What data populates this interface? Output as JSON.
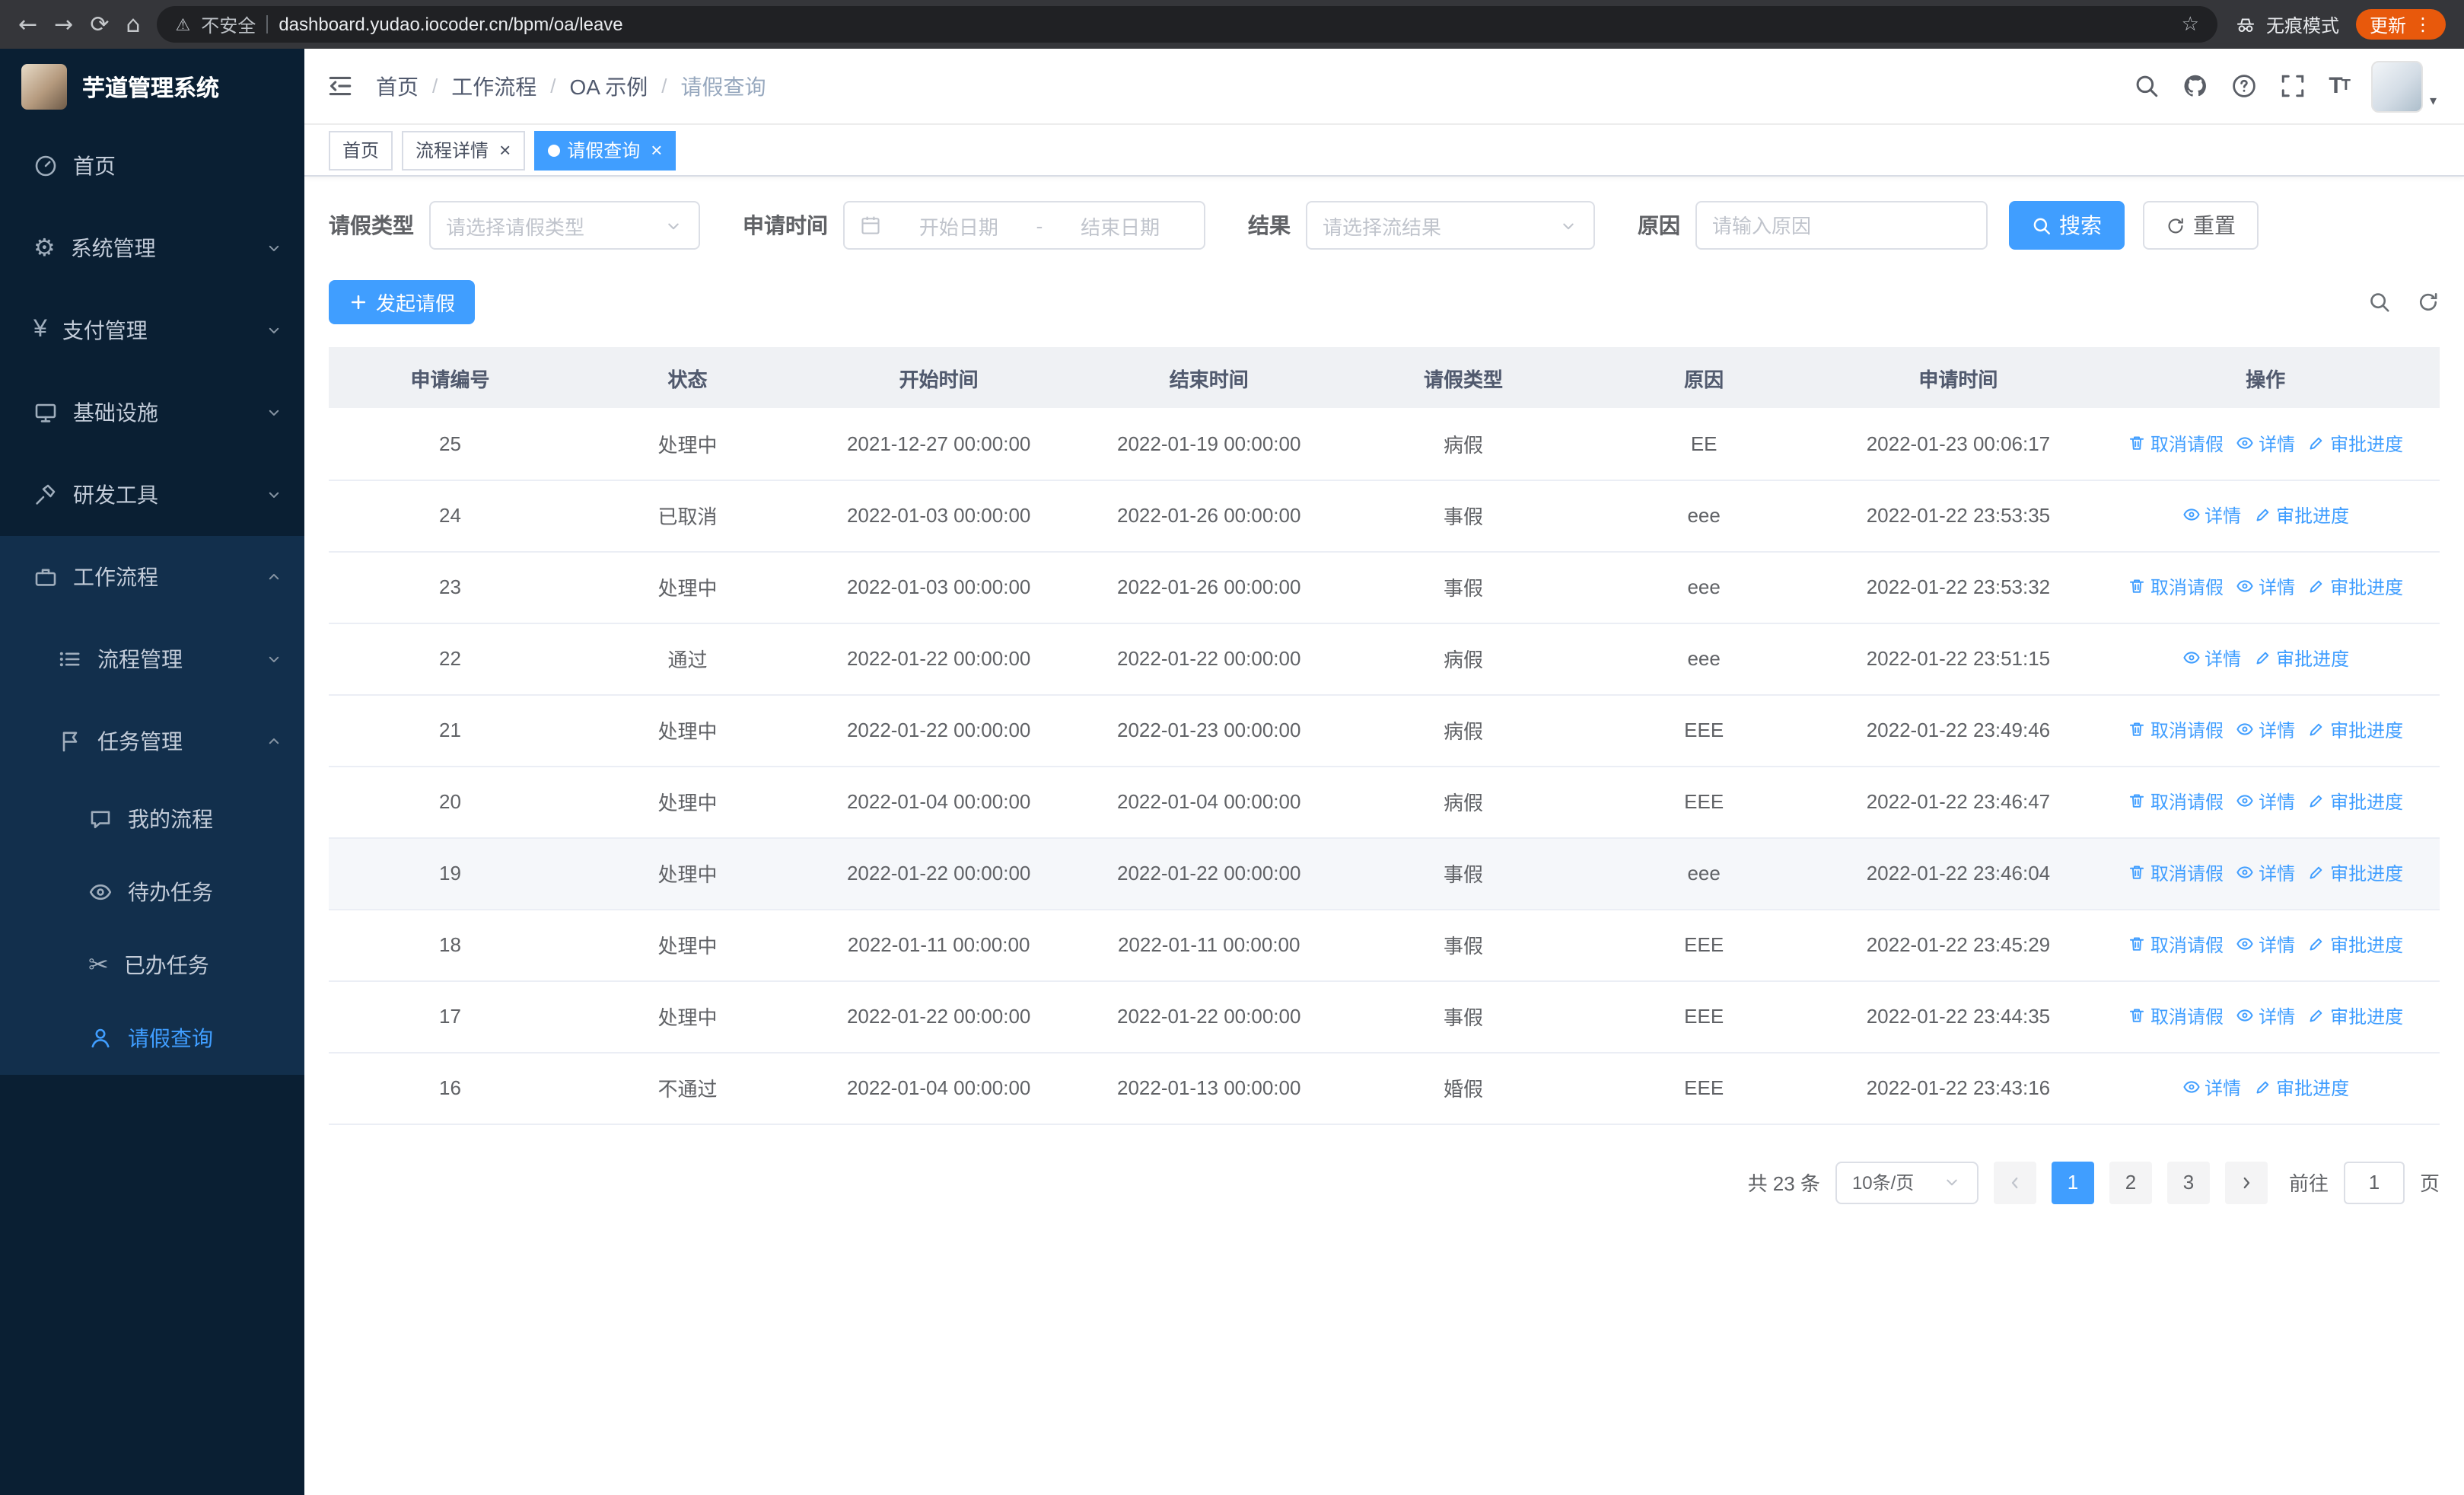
{
  "browser": {
    "security_warning": "不安全",
    "url": "dashboard.yudao.iocoder.cn/bpm/oa/leave",
    "incognito_label": "无痕模式",
    "update_label": "更新"
  },
  "sidebar": {
    "logo_title": "芋道管理系统",
    "menu": [
      {
        "id": "home",
        "label": "首页",
        "icon": "dashboard-icon",
        "level": 1
      },
      {
        "id": "system-mgmt",
        "label": "系统管理",
        "icon": "gear-icon",
        "level": 1,
        "chevron": "down"
      },
      {
        "id": "payment-mgmt",
        "label": "支付管理",
        "icon": "yen-icon",
        "level": 1,
        "chevron": "down"
      },
      {
        "id": "infrastructure",
        "label": "基础设施",
        "icon": "monitor-icon",
        "level": 1,
        "chevron": "down"
      },
      {
        "id": "dev-tools",
        "label": "研发工具",
        "icon": "tools-icon",
        "level": 1,
        "chevron": "down"
      },
      {
        "id": "workflow",
        "label": "工作流程",
        "icon": "briefcase-icon",
        "level": 1,
        "chevron": "up",
        "group": true
      },
      {
        "id": "process-mgmt",
        "label": "流程管理",
        "icon": "list-icon",
        "level": 2,
        "chevron": "down",
        "group": true
      },
      {
        "id": "task-mgmt",
        "label": "任务管理",
        "icon": "flag-icon",
        "level": 2,
        "chevron": "up",
        "group": true
      },
      {
        "id": "my-process",
        "label": "我的流程",
        "icon": "chat-icon",
        "level": 3,
        "group": true
      },
      {
        "id": "todo-task",
        "label": "待办任务",
        "icon": "eye-icon",
        "level": 3,
        "group": true
      },
      {
        "id": "done-task",
        "label": "已办任务",
        "icon": "scissors-icon",
        "level": 3,
        "group": true
      },
      {
        "id": "leave-query",
        "label": "请假查询",
        "icon": "user-icon",
        "level": 3,
        "group": true,
        "active": true
      }
    ]
  },
  "breadcrumb": {
    "separator": "/",
    "items": [
      "首页",
      "工作流程",
      "OA 示例",
      "请假查询"
    ]
  },
  "tabs": [
    {
      "label": "首页",
      "closable": false,
      "active": false
    },
    {
      "label": "流程详情",
      "closable": true,
      "active": false
    },
    {
      "label": "请假查询",
      "closable": true,
      "active": true
    }
  ],
  "filters": {
    "leave_type_label": "请假类型",
    "leave_type_placeholder": "请选择请假类型",
    "apply_time_label": "申请时间",
    "start_date_placeholder": "开始日期",
    "date_separator": "-",
    "end_date_placeholder": "结束日期",
    "result_label": "结果",
    "result_placeholder": "请选择流结果",
    "reason_label": "原因",
    "reason_placeholder": "请输入原因",
    "search_button": "搜索",
    "reset_button": "重置"
  },
  "toolbar": {
    "create_button": "发起请假"
  },
  "table": {
    "columns": [
      "申请编号",
      "状态",
      "开始时间",
      "结束时间",
      "请假类型",
      "原因",
      "申请时间",
      "操作"
    ],
    "action_icons": {
      "取消请假": "delete-icon",
      "详情": "view-icon",
      "审批进度": "edit-icon"
    },
    "action_names": {
      "取消请假": "cancel-leave-link",
      "详情": "detail-link",
      "审批进度": "approval-progress-link"
    },
    "rows": [
      {
        "id": "25",
        "status": "处理中",
        "start_time": "2021-12-27 00:00:00",
        "end_time": "2022-01-19 00:00:00",
        "leave_type": "病假",
        "reason": "EE",
        "apply_time": "2022-01-23 00:06:17",
        "actions": [
          "取消请假",
          "详情",
          "审批进度"
        ]
      },
      {
        "id": "24",
        "status": "已取消",
        "start_time": "2022-01-03 00:00:00",
        "end_time": "2022-01-26 00:00:00",
        "leave_type": "事假",
        "reason": "eee",
        "apply_time": "2022-01-22 23:53:35",
        "actions": [
          "详情",
          "审批进度"
        ]
      },
      {
        "id": "23",
        "status": "处理中",
        "start_time": "2022-01-03 00:00:00",
        "end_time": "2022-01-26 00:00:00",
        "leave_type": "事假",
        "reason": "eee",
        "apply_time": "2022-01-22 23:53:32",
        "actions": [
          "取消请假",
          "详情",
          "审批进度"
        ]
      },
      {
        "id": "22",
        "status": "通过",
        "start_time": "2022-01-22 00:00:00",
        "end_time": "2022-01-22 00:00:00",
        "leave_type": "病假",
        "reason": "eee",
        "apply_time": "2022-01-22 23:51:15",
        "actions": [
          "详情",
          "审批进度"
        ]
      },
      {
        "id": "21",
        "status": "处理中",
        "start_time": "2022-01-22 00:00:00",
        "end_time": "2022-01-23 00:00:00",
        "leave_type": "病假",
        "reason": "EEE",
        "apply_time": "2022-01-22 23:49:46",
        "actions": [
          "取消请假",
          "详情",
          "审批进度"
        ]
      },
      {
        "id": "20",
        "status": "处理中",
        "start_time": "2022-01-04 00:00:00",
        "end_time": "2022-01-04 00:00:00",
        "leave_type": "病假",
        "reason": "EEE",
        "apply_time": "2022-01-22 23:46:47",
        "actions": [
          "取消请假",
          "详情",
          "审批进度"
        ]
      },
      {
        "id": "19",
        "status": "处理中",
        "start_time": "2022-01-22 00:00:00",
        "end_time": "2022-01-22 00:00:00",
        "leave_type": "事假",
        "reason": "eee",
        "apply_time": "2022-01-22 23:46:04",
        "actions": [
          "取消请假",
          "详情",
          "审批进度"
        ],
        "highlighted": true
      },
      {
        "id": "18",
        "status": "处理中",
        "start_time": "2022-01-11 00:00:00",
        "end_time": "2022-01-11 00:00:00",
        "leave_type": "事假",
        "reason": "EEE",
        "apply_time": "2022-01-22 23:45:29",
        "actions": [
          "取消请假",
          "详情",
          "审批进度"
        ]
      },
      {
        "id": "17",
        "status": "处理中",
        "start_time": "2022-01-22 00:00:00",
        "end_time": "2022-01-22 00:00:00",
        "leave_type": "事假",
        "reason": "EEE",
        "apply_time": "2022-01-22 23:44:35",
        "actions": [
          "取消请假",
          "详情",
          "审批进度"
        ]
      },
      {
        "id": "16",
        "status": "不通过",
        "start_time": "2022-01-04 00:00:00",
        "end_time": "2022-01-13 00:00:00",
        "leave_type": "婚假",
        "reason": "EEE",
        "apply_time": "2022-01-22 23:43:16",
        "actions": [
          "详情",
          "审批进度"
        ]
      }
    ]
  },
  "pagination": {
    "total_label": "共 23 条",
    "page_size_label": "10条/页",
    "pages": [
      {
        "label": "1",
        "active": true
      },
      {
        "label": "2",
        "active": false
      },
      {
        "label": "3",
        "active": false
      }
    ],
    "goto_label": "前往",
    "goto_value": "1",
    "goto_suffix": "页"
  },
  "colors": {
    "primary": "#409eff",
    "sidebar_bg": "#0a1f33",
    "sidebar_group_bg": "#122f4c",
    "table_header_bg": "#eff1f4",
    "update_badge": "#e8590c"
  }
}
